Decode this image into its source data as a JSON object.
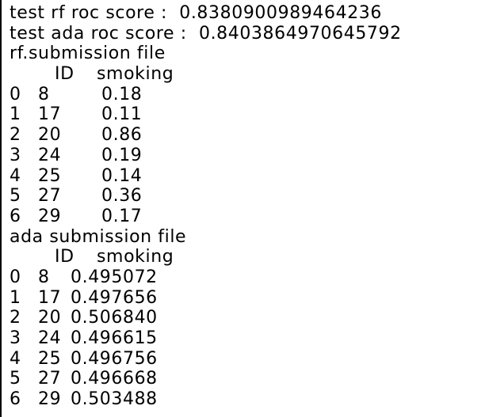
{
  "console": {
    "rf_score_line": "test rf roc score :  0.8380900989464236",
    "ada_score_line": "test ada roc score :  0.8403864970645792",
    "rf_title": "rf.submission file",
    "ada_title": "ada submission file"
  },
  "rf_table": {
    "headers": {
      "id": "ID",
      "smoking": "smoking"
    },
    "rows": [
      {
        "index": "0",
        "id": "8",
        "smoking": "0.18"
      },
      {
        "index": "1",
        "id": "17",
        "smoking": "0.11"
      },
      {
        "index": "2",
        "id": "20",
        "smoking": "0.86"
      },
      {
        "index": "3",
        "id": "24",
        "smoking": "0.19"
      },
      {
        "index": "4",
        "id": "25",
        "smoking": "0.14"
      },
      {
        "index": "5",
        "id": "27",
        "smoking": "0.36"
      },
      {
        "index": "6",
        "id": "29",
        "smoking": "0.17"
      }
    ]
  },
  "ada_table": {
    "headers": {
      "id": "ID",
      "smoking": "smoking"
    },
    "rows": [
      {
        "index": "0",
        "id": "8",
        "smoking": "0.495072"
      },
      {
        "index": "1",
        "id": "17",
        "smoking": "0.497656"
      },
      {
        "index": "2",
        "id": "20",
        "smoking": "0.506840"
      },
      {
        "index": "3",
        "id": "24",
        "smoking": "0.496615"
      },
      {
        "index": "4",
        "id": "25",
        "smoking": "0.496756"
      },
      {
        "index": "5",
        "id": "27",
        "smoking": "0.496668"
      },
      {
        "index": "6",
        "id": "29",
        "smoking": "0.503488"
      }
    ]
  }
}
